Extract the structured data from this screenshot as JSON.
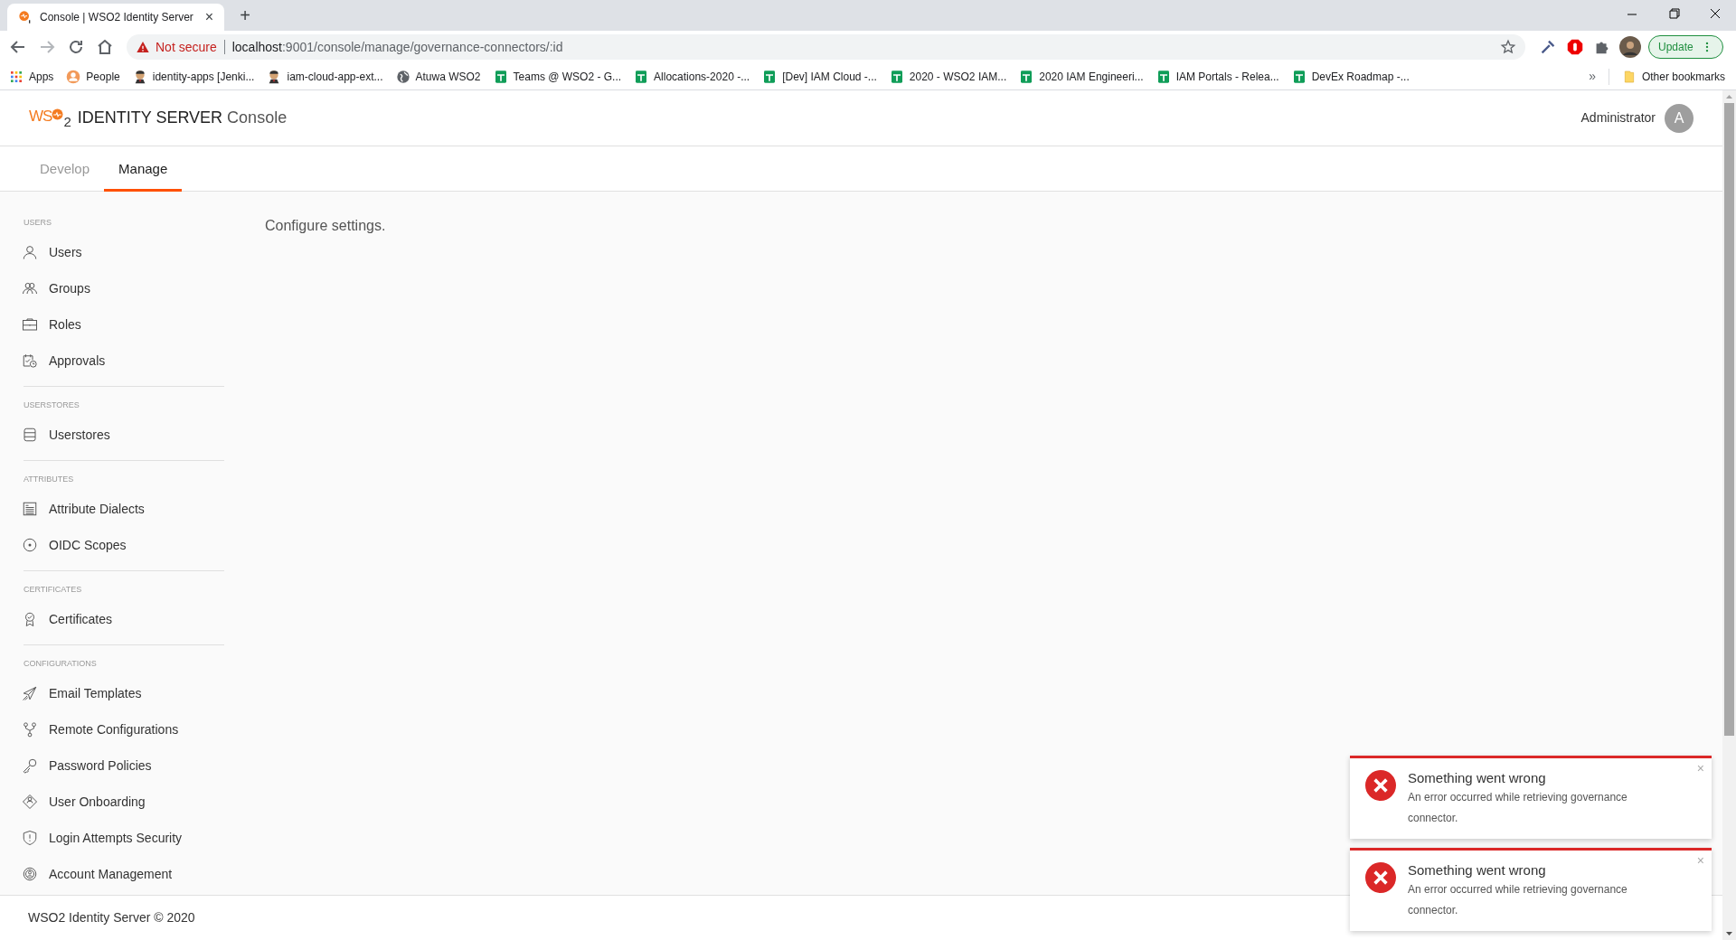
{
  "browser": {
    "tab": {
      "title": "Console | WSO2 Identity Server",
      "close": "×"
    },
    "new_tab": "+",
    "address": {
      "warning": "Not secure",
      "host": "localhost",
      "path": ":9001/console/manage/governance-connectors/:id"
    },
    "update_button": "Update",
    "bookmarks": [
      {
        "label": "Apps",
        "kind": "grid"
      },
      {
        "label": "People",
        "kind": "person"
      },
      {
        "label": "identity-apps [Jenki...",
        "kind": "butler"
      },
      {
        "label": "iam-cloud-app-ext...",
        "kind": "butler"
      },
      {
        "label": "Atuwa WSO2",
        "kind": "globe"
      },
      {
        "label": "Teams @ WSO2 - G...",
        "kind": "sheet"
      },
      {
        "label": "Allocations-2020 -...",
        "kind": "sheet"
      },
      {
        "label": "[Dev] IAM Cloud -...",
        "kind": "sheet"
      },
      {
        "label": "2020 - WSO2 IAM...",
        "kind": "sheet"
      },
      {
        "label": "2020 IAM Engineeri...",
        "kind": "sheet"
      },
      {
        "label": "IAM Portals - Relea...",
        "kind": "sheet"
      },
      {
        "label": "DevEx Roadmap -...",
        "kind": "sheet"
      }
    ],
    "more_bookmarks": "»",
    "other_bookmarks": "Other bookmarks"
  },
  "header": {
    "logo": {
      "prefix": "WS",
      "suffix": "2"
    },
    "product": "IDENTITY SERVER",
    "product_suffix": "Console",
    "user": "Administrator",
    "avatar": "A"
  },
  "tabs": [
    {
      "label": "Develop",
      "selected": false
    },
    {
      "label": "Manage",
      "selected": true
    }
  ],
  "sidebar": [
    {
      "title": "USERS",
      "items": [
        {
          "label": "Users",
          "kind": "user"
        },
        {
          "label": "Groups",
          "kind": "group"
        },
        {
          "label": "Roles",
          "kind": "briefcase"
        },
        {
          "label": "Approvals",
          "kind": "approval"
        }
      ]
    },
    {
      "title": "USERSTORES",
      "items": [
        {
          "label": "Userstores",
          "kind": "database"
        }
      ]
    },
    {
      "title": "ATTRIBUTES",
      "items": [
        {
          "label": "Attribute Dialects",
          "kind": "document"
        },
        {
          "label": "OIDC Scopes",
          "kind": "target"
        }
      ]
    },
    {
      "title": "CERTIFICATES",
      "items": [
        {
          "label": "Certificates",
          "kind": "award"
        }
      ]
    },
    {
      "title": "CONFIGURATIONS",
      "items": [
        {
          "label": "Email Templates",
          "kind": "plane"
        },
        {
          "label": "Remote Configurations",
          "kind": "fork"
        },
        {
          "label": "Password Policies",
          "kind": "key"
        },
        {
          "label": "User Onboarding",
          "kind": "onboard"
        },
        {
          "label": "Login Attempts Security",
          "kind": "shield"
        },
        {
          "label": "Account Management",
          "kind": "gear"
        }
      ]
    }
  ],
  "content": {
    "text": "Configure settings."
  },
  "footer": {
    "text": "WSO2 Identity Server © 2020"
  },
  "notifications": [
    {
      "title": "Something went wrong",
      "message": "An error occurred while retrieving governance connector.",
      "close": "×"
    },
    {
      "title": "Something went wrong",
      "message": "An error occurred while retrieving governance connector.",
      "close": "×"
    }
  ]
}
